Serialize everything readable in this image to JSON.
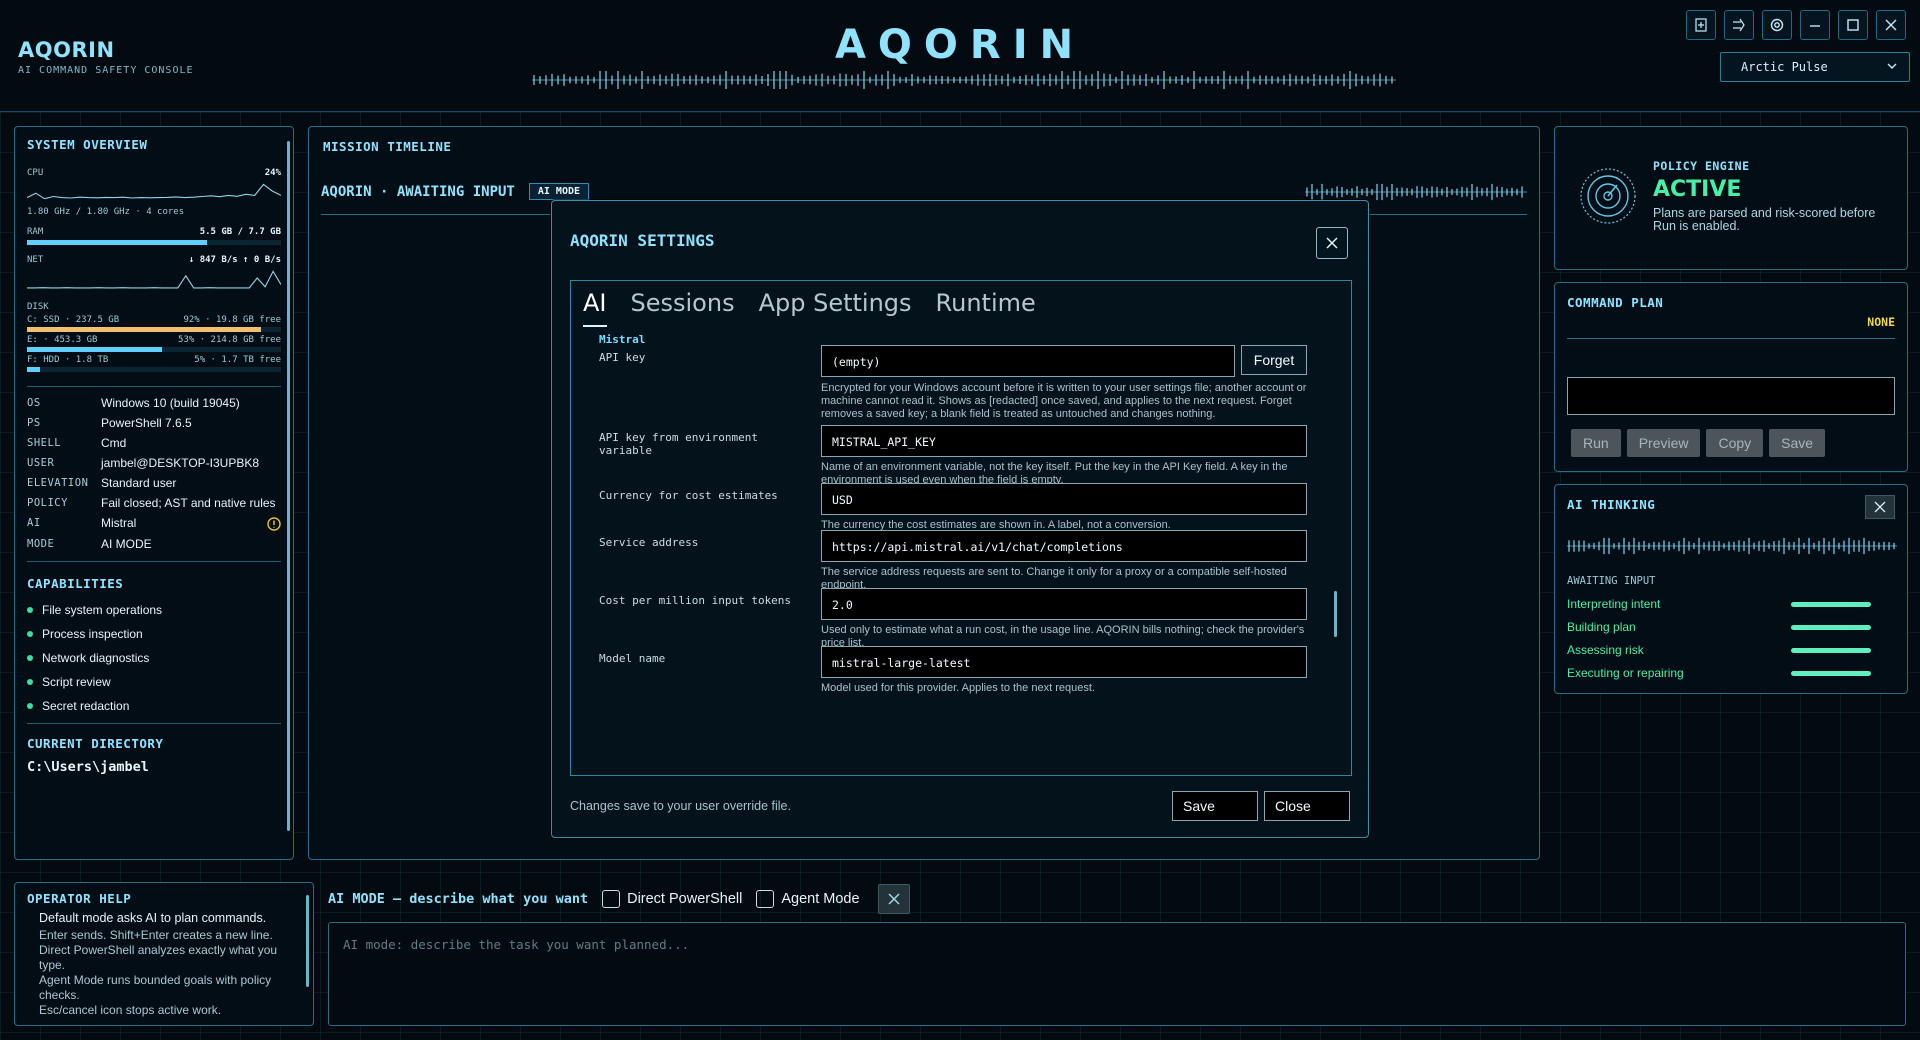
{
  "app": {
    "title": "AQORIN",
    "subtitle": "AI COMMAND SAFETY CONSOLE",
    "center_title": "AQORIN",
    "theme": "Arctic Pulse"
  },
  "icons": {
    "win": [
      "new-window-icon",
      "export-icon",
      "settings-icon",
      "minimize-icon",
      "maximize-icon",
      "close-icon"
    ]
  },
  "colors": {
    "accent": "#8fe3ff",
    "ram_bar": "#5fd0ff",
    "disk_c_bar": "#f0c070",
    "active": "#46f0a6",
    "warn": "#f0c030"
  },
  "system": {
    "heading": "SYSTEM OVERVIEW",
    "cpu": {
      "label": "CPU",
      "value": "24%",
      "detail": "1.80 GHz / 1.80 GHz · 4 cores"
    },
    "ram": {
      "label": "RAM",
      "value": "5.5 GB / 7.7 GB",
      "fraction": 0.71
    },
    "net": {
      "label": "NET",
      "value": "↓ 847 B/s  ↑ 0 B/s"
    },
    "disk": {
      "label": "DISK",
      "drives": [
        {
          "name": "C: SSD · 237.5 GB",
          "usage": "92% · 19.8 GB free",
          "fraction": 0.92
        },
        {
          "name": "E: · 453.3 GB",
          "usage": "53% · 214.8 GB free",
          "fraction": 0.53
        },
        {
          "name": "F: HDD · 1.8 TB",
          "usage": "5% · 1.7 TB free",
          "fraction": 0.05
        }
      ]
    },
    "info": [
      {
        "key": "OS",
        "value": "Windows 10 (build 19045)"
      },
      {
        "key": "PS",
        "value": "PowerShell 7.6.5"
      },
      {
        "key": "SHELL",
        "value": "Cmd"
      },
      {
        "key": "USER",
        "value": "jambel@DESKTOP-I3UPBK8"
      },
      {
        "key": "ELEVATION",
        "value": "Standard user"
      },
      {
        "key": "POLICY",
        "value": "Fail closed; AST and native rules"
      },
      {
        "key": "AI",
        "value": "Mistral"
      },
      {
        "key": "MODE",
        "value": "AI MODE"
      }
    ],
    "capabilities_heading": "CAPABILITIES",
    "capabilities": [
      "File system operations",
      "Process inspection",
      "Network diagnostics",
      "Script review",
      "Secret redaction"
    ],
    "cwd_heading": "CURRENT DIRECTORY",
    "cwd": "C:\\Users\\jambel"
  },
  "mission": {
    "heading": "MISSION TIMELINE",
    "status": "AQORIN · AWAITING INPUT",
    "mode_chip": "AI MODE"
  },
  "policy": {
    "heading": "POLICY ENGINE",
    "state": "ACTIVE",
    "description": "Plans are parsed and risk-scored before Run is enabled."
  },
  "command_plan": {
    "heading": "COMMAND PLAN",
    "risk": "NONE",
    "buttons": [
      "Run",
      "Preview",
      "Copy",
      "Save"
    ]
  },
  "thinking": {
    "heading": "AI THINKING",
    "status": "AWAITING INPUT",
    "steps": [
      "Interpreting intent",
      "Building plan",
      "Assessing risk",
      "Executing or repairing"
    ]
  },
  "help": {
    "heading": "OPERATOR HELP",
    "lead": "Default mode asks AI to plan commands.",
    "lines": [
      "Enter sends. Shift+Enter creates a new line.",
      "Direct PowerShell analyzes exactly what you type.",
      "Agent Mode runs bounded goals with policy checks.",
      "Esc/cancel icon stops active work."
    ]
  },
  "prompt": {
    "label": "AI MODE — describe what you want",
    "direct_label": "Direct PowerShell",
    "agent_label": "Agent Mode",
    "placeholder": "AI mode: describe the task you want planned..."
  },
  "settings": {
    "title": "AQORIN SETTINGS",
    "tabs": [
      "AI",
      "Sessions",
      "App Settings",
      "Runtime"
    ],
    "section": "Mistral",
    "fields": [
      {
        "label": "API key",
        "value": "(empty)",
        "button": "Forget",
        "help": "Encrypted for your Windows account before it is written to your user settings file; another account or machine cannot read it. Shows as [redacted] once saved, and applies to the next request. Forget removes a saved key; a blank field is treated as untouched and changes nothing."
      },
      {
        "label": "API key from environment variable",
        "value": "MISTRAL_API_KEY",
        "help": "Name of an environment variable, not the key itself. Put the key in the API Key field. A key in the environment is used even when the field is empty."
      },
      {
        "label": "Currency for cost estimates",
        "value": "USD",
        "help": "The currency the cost estimates are shown in. A label, not a conversion."
      },
      {
        "label": "Service address",
        "value": "https://api.mistral.ai/v1/chat/completions",
        "help": "The service address requests are sent to. Change it only for a proxy or a compatible self-hosted endpoint."
      },
      {
        "label": "Cost per million input tokens",
        "value": "2.0",
        "help": "Used only to estimate what a run cost, in the usage line. AQORIN bills nothing; check the provider's price list."
      },
      {
        "label": "Model name",
        "value": "mistral-large-latest",
        "help": "Model used for this provider. Applies to the next request."
      }
    ],
    "footer": "Changes save to your user override file.",
    "save": "Save",
    "close": "Close"
  }
}
